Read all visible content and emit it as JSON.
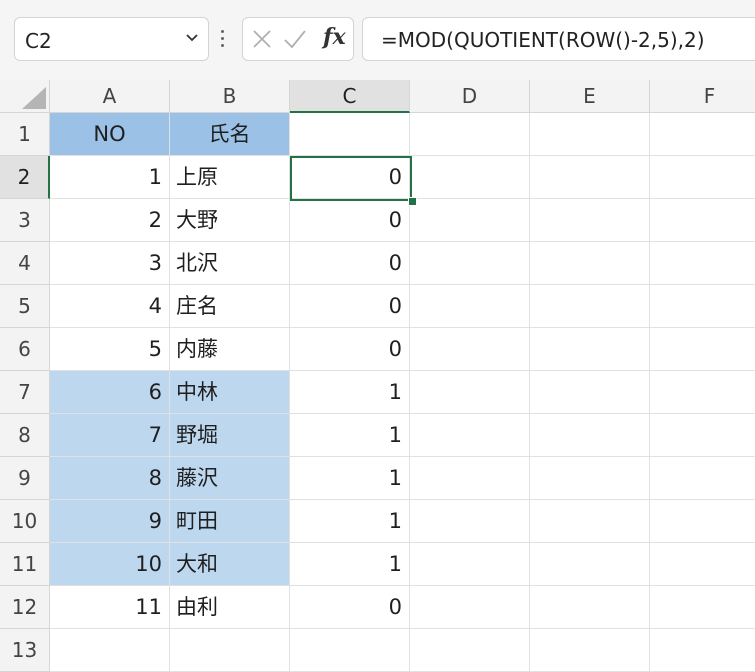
{
  "name_box": {
    "value": "C2"
  },
  "formula_bar": {
    "formula": "=MOD(QUOTIENT(ROW()-2,5),2)",
    "fx_label": "fx"
  },
  "colors": {
    "header_fill": "#9bc2e6",
    "band_fill": "#bdd7ee",
    "selection": "#217346"
  },
  "icons": {
    "cancel": "x-icon",
    "enter": "check-icon",
    "function": "fx-icon",
    "dropdown": "chevron-down-icon"
  },
  "columns": [
    "A",
    "B",
    "C",
    "D",
    "E",
    "F"
  ],
  "active_column": "C",
  "active_row": "2",
  "rows": [
    {
      "row": "1",
      "a": "NO",
      "b": "氏名",
      "c": ""
    },
    {
      "row": "2",
      "a": "1",
      "b": "上原",
      "c": "0"
    },
    {
      "row": "3",
      "a": "2",
      "b": "大野",
      "c": "0"
    },
    {
      "row": "4",
      "a": "3",
      "b": "北沢",
      "c": "0"
    },
    {
      "row": "5",
      "a": "4",
      "b": "庄名",
      "c": "0"
    },
    {
      "row": "6",
      "a": "5",
      "b": "内藤",
      "c": "0"
    },
    {
      "row": "7",
      "a": "6",
      "b": "中林",
      "c": "1"
    },
    {
      "row": "8",
      "a": "7",
      "b": "野堀",
      "c": "1"
    },
    {
      "row": "9",
      "a": "8",
      "b": "藤沢",
      "c": "1"
    },
    {
      "row": "10",
      "a": "9",
      "b": "町田",
      "c": "1"
    },
    {
      "row": "11",
      "a": "10",
      "b": "大和",
      "c": "1"
    },
    {
      "row": "12",
      "a": "11",
      "b": "由利",
      "c": "0"
    },
    {
      "row": "13",
      "a": "",
      "b": "",
      "c": ""
    }
  ]
}
